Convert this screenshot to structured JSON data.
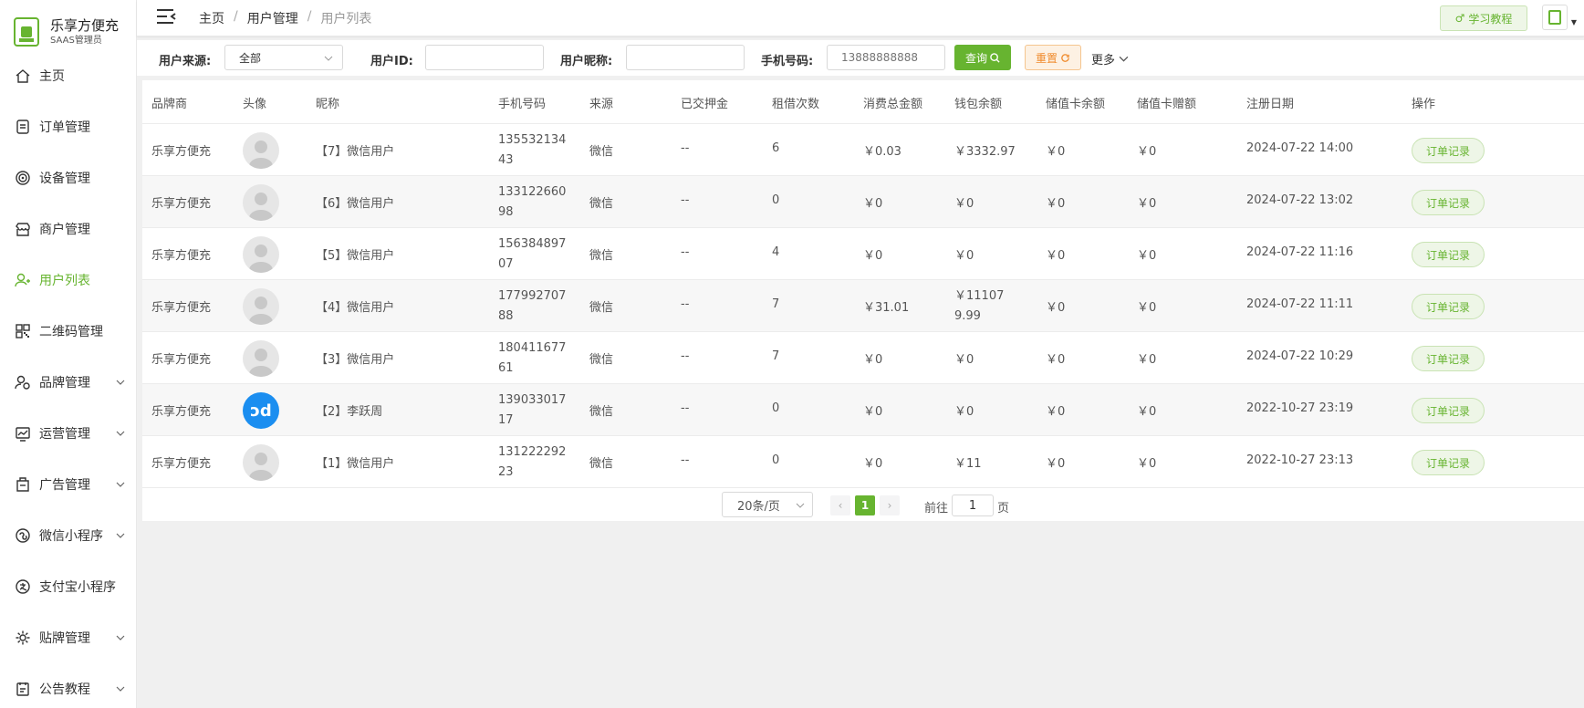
{
  "brand": {
    "title": "乐享方便充",
    "subtitle": "SAAS管理员"
  },
  "sidebar": {
    "items": [
      {
        "label": "主页",
        "icon": "home-icon"
      },
      {
        "label": "订单管理",
        "icon": "order-icon"
      },
      {
        "label": "设备管理",
        "icon": "device-icon"
      },
      {
        "label": "商户管理",
        "icon": "shop-icon"
      },
      {
        "label": "用户列表",
        "icon": "user-add-icon",
        "active": true
      },
      {
        "label": "二维码管理",
        "icon": "qrcode-icon"
      },
      {
        "label": "品牌管理",
        "icon": "brand-icon",
        "expandable": true
      },
      {
        "label": "运营管理",
        "icon": "chart-icon",
        "expandable": true
      },
      {
        "label": "广告管理",
        "icon": "ad-icon",
        "expandable": true
      },
      {
        "label": "微信小程序",
        "icon": "wechat-icon",
        "expandable": true
      },
      {
        "label": "支付宝小程序",
        "icon": "alipay-icon"
      },
      {
        "label": "贴牌管理",
        "icon": "gear-icon",
        "expandable": true
      },
      {
        "label": "公告教程",
        "icon": "notice-icon",
        "expandable": true
      }
    ]
  },
  "header": {
    "breadcrumb": [
      "主页",
      "用户管理",
      "用户列表"
    ],
    "tutorial_label": "学习教程"
  },
  "filters": {
    "source_label": "用户来源:",
    "source_value": "全部",
    "user_id_label": "用户ID:",
    "user_id_value": "",
    "nickname_label": "用户昵称:",
    "nickname_value": "",
    "phone_label": "手机号码:",
    "phone_placeholder": "13888888888",
    "query_label": "查询",
    "reset_label": "重置",
    "more_label": "更多"
  },
  "table": {
    "headers": [
      "品牌商",
      "头像",
      "昵称",
      "手机号码",
      "来源",
      "已交押金",
      "租借次数",
      "消费总金额",
      "钱包余额",
      "储值卡余额",
      "储值卡赠额",
      "注册日期",
      "操作"
    ],
    "rows": [
      {
        "brand": "乐享方便充",
        "nickname": "【7】微信用户",
        "phone": "13553213443",
        "source": "微信",
        "deposit": "--",
        "rent_count": "6",
        "total_spent": "￥0.03",
        "wallet": "￥3332.97",
        "card_balance": "￥0",
        "card_bonus": "￥0",
        "reg_date": "2024-07-22 14:00",
        "action": "订单记录",
        "avatar": "default"
      },
      {
        "brand": "乐享方便充",
        "nickname": "【6】微信用户",
        "phone": "13312266098",
        "source": "微信",
        "deposit": "--",
        "rent_count": "0",
        "total_spent": "￥0",
        "wallet": "￥0",
        "card_balance": "￥0",
        "card_bonus": "￥0",
        "reg_date": "2024-07-22 13:02",
        "action": "订单记录",
        "avatar": "default"
      },
      {
        "brand": "乐享方便充",
        "nickname": "【5】微信用户",
        "phone": "15638489707",
        "source": "微信",
        "deposit": "--",
        "rent_count": "4",
        "total_spent": "￥0",
        "wallet": "￥0",
        "card_balance": "￥0",
        "card_bonus": "￥0",
        "reg_date": "2024-07-22 11:16",
        "action": "订单记录",
        "avatar": "default"
      },
      {
        "brand": "乐享方便充",
        "nickname": "【4】微信用户",
        "phone": "17799270788",
        "source": "微信",
        "deposit": "--",
        "rent_count": "7",
        "total_spent": "￥31.01",
        "wallet": "￥111079.99",
        "card_balance": "￥0",
        "card_bonus": "￥0",
        "reg_date": "2024-07-22 11:11",
        "action": "订单记录",
        "avatar": "default"
      },
      {
        "brand": "乐享方便充",
        "nickname": "【3】微信用户",
        "phone": "18041167761",
        "source": "微信",
        "deposit": "--",
        "rent_count": "7",
        "total_spent": "￥0",
        "wallet": "￥0",
        "card_balance": "￥0",
        "card_bonus": "￥0",
        "reg_date": "2024-07-22 10:29",
        "action": "订单记录",
        "avatar": "default"
      },
      {
        "brand": "乐享方便充",
        "nickname": "【2】李跃周",
        "phone": "13903301717",
        "source": "微信",
        "deposit": "--",
        "rent_count": "0",
        "total_spent": "￥0",
        "wallet": "￥0",
        "card_balance": "￥0",
        "card_bonus": "￥0",
        "reg_date": "2022-10-27 23:19",
        "action": "订单记录",
        "avatar": "custom"
      },
      {
        "brand": "乐享方便充",
        "nickname": "【1】微信用户",
        "phone": "13122229223",
        "source": "微信",
        "deposit": "--",
        "rent_count": "0",
        "total_spent": "￥0",
        "wallet": "￥11",
        "card_balance": "￥0",
        "card_bonus": "￥0",
        "reg_date": "2022-10-27 23:13",
        "action": "订单记录",
        "avatar": "default"
      }
    ]
  },
  "pagination": {
    "page_size": "20条/页",
    "current_page": "1",
    "goto_label": "前往",
    "goto_value": "1",
    "page_suffix": "页"
  },
  "colors": {
    "accent": "#67b430",
    "reset": "#f08b2d",
    "avatar_blue": "#1b8ef0"
  }
}
